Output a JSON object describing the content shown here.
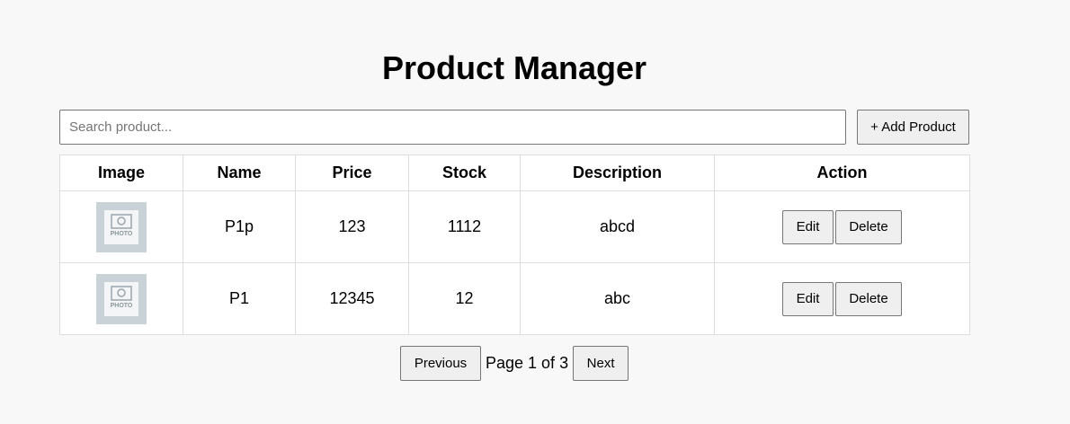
{
  "header": {
    "title": "Product Manager"
  },
  "toolbar": {
    "search_placeholder": "Search product...",
    "search_value": "",
    "add_label": "+ Add Product"
  },
  "table": {
    "columns": [
      "Image",
      "Name",
      "Price",
      "Stock",
      "Description",
      "Action"
    ],
    "rows": [
      {
        "image_icon": "photo-placeholder-icon",
        "image_text": "PHOTO",
        "name": "P1p",
        "price": "123",
        "stock": "1112",
        "description": "abcd",
        "edit_label": "Edit",
        "delete_label": "Delete"
      },
      {
        "image_icon": "photo-placeholder-icon",
        "image_text": "PHOTO",
        "name": "P1",
        "price": "12345",
        "stock": "12",
        "description": "abc",
        "edit_label": "Edit",
        "delete_label": "Delete"
      }
    ]
  },
  "pagination": {
    "prev_label": "Previous",
    "page_text": "Page 1 of 3",
    "next_label": "Next"
  },
  "colors": {
    "background": "#f8f8f8",
    "button_bg": "#efefef",
    "border": "#dddddd",
    "thumb_bg": "#c9d3d7"
  }
}
